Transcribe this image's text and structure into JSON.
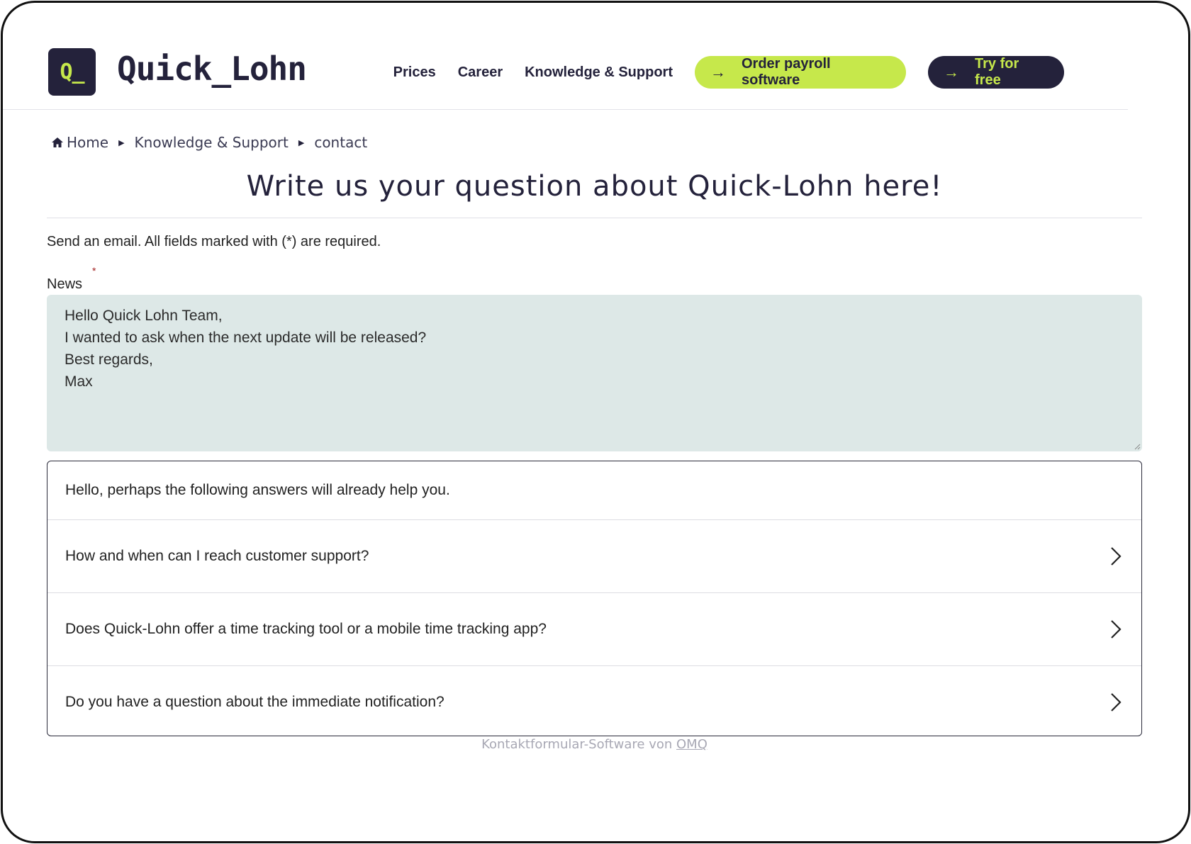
{
  "header": {
    "logo_mark": "Q_",
    "logo_text": "Quick_Lohn",
    "nav": [
      "Prices",
      "Career",
      "Knowledge & Support"
    ],
    "order_button": "Order payroll software",
    "try_button": "Try for free"
  },
  "breadcrumb": {
    "items": [
      "Home",
      "Knowledge & Support",
      "contact"
    ]
  },
  "page_title": "Write us your question about Quick-Lohn here!",
  "intro": "Send an email. All fields marked with (*) are required.",
  "form": {
    "message_label": "News",
    "required_mark": "*",
    "message_lines": [
      "Hello Quick Lohn Team,",
      "I wanted to ask when the next update will be released?",
      "Best regards,",
      "Max"
    ]
  },
  "faq": {
    "heading": "Hello, perhaps the following answers will already help you.",
    "items": [
      "How and when can I reach customer support?",
      "Does Quick-Lohn offer a time tracking tool or a mobile time tracking app?",
      "Do you have a question about the immediate notification?"
    ]
  },
  "credit": {
    "text": "Kontaktformular-Software von ",
    "link": "OMQ"
  },
  "colors": {
    "brand_dark": "#24223b",
    "brand_lime": "#c6e84b",
    "textarea_bg": "#dde8e7"
  }
}
